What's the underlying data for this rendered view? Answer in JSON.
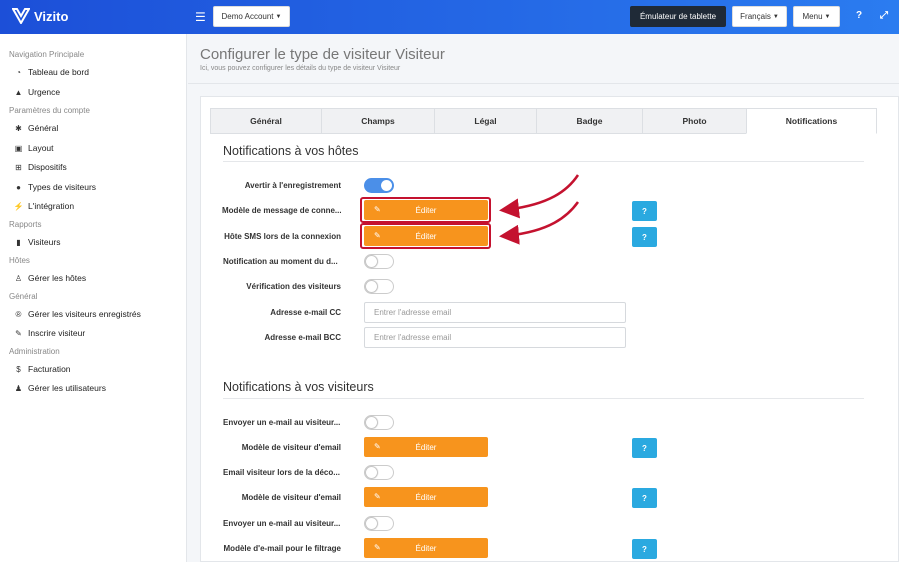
{
  "app": {
    "name": "Vizito"
  },
  "topbar": {
    "account": "Demo Account",
    "tablet_emulator": "Émulateur de tablette",
    "language": "Français",
    "menu": "Menu",
    "help_icon": "?"
  },
  "sidebar": {
    "sections": [
      {
        "title": "Navigation Principale",
        "items": [
          {
            "label": "Tableau de bord",
            "icon": "dashboard-icon"
          },
          {
            "label": "Urgence",
            "icon": "warning-icon"
          }
        ]
      },
      {
        "title": "Paramètres du compte",
        "items": [
          {
            "label": "Général",
            "icon": "gear-icon"
          },
          {
            "label": "Layout",
            "icon": "image-icon"
          },
          {
            "label": "Dispositifs",
            "icon": "sitemap-icon"
          },
          {
            "label": "Types de visiteurs",
            "icon": "users-icon"
          },
          {
            "label": "L'intégration",
            "icon": "plug-icon"
          }
        ]
      },
      {
        "title": "Rapports",
        "items": [
          {
            "label": "Visiteurs",
            "icon": "book-icon"
          }
        ]
      },
      {
        "title": "Hôtes",
        "items": [
          {
            "label": "Gérer les hôtes",
            "icon": "person-icon"
          }
        ]
      },
      {
        "title": "Général",
        "items": [
          {
            "label": "Gérer les visiteurs enregistrés",
            "icon": "registered-icon"
          },
          {
            "label": "Inscrire visiteur",
            "icon": "pencil-icon"
          }
        ]
      },
      {
        "title": "Administration",
        "items": [
          {
            "label": "Facturation",
            "icon": "dollar-icon"
          },
          {
            "label": "Gérer les utilisateurs",
            "icon": "user-plus-icon"
          }
        ]
      }
    ]
  },
  "page": {
    "title": "Configurer le type de visiteur Visiteur",
    "subtitle": "Ici, vous pouvez configurer les détails du type de visiteur Visiteur"
  },
  "tabs": [
    "Général",
    "Champs",
    "Légal",
    "Badge",
    "Photo",
    "Notifications"
  ],
  "hosts": {
    "title": "Notifications à vos hôtes",
    "rows": {
      "notify_register": "Avertir à l'enregistrement",
      "message_template": "Modèle de message de conne...",
      "sms_host": "Hôte SMS lors de la connexion",
      "notify_moment": "Notification au moment du d...",
      "visitor_check": "Vérification des visiteurs",
      "cc_email": "Adresse e-mail CC",
      "bcc_email": "Adresse e-mail BCC"
    },
    "cc_placeholder": "Entrer l'adresse email",
    "bcc_placeholder": "Entrer l'adresse email",
    "notify_register_on": true
  },
  "visitors": {
    "title": "Notifications à vos visiteurs",
    "rows": {
      "send_email_1": "Envoyer un e-mail au visiteur...",
      "email_template_1": "Modèle de visiteur d'email",
      "email_logout": "Email visiteur lors de la déco...",
      "email_template_2": "Modèle de visiteur d'email",
      "send_email_2": "Envoyer un e-mail au visiteur...",
      "filter_template": "Modèle d'e-mail pour le filtrage"
    }
  },
  "buttons": {
    "edit": "Éditer",
    "help": "?"
  },
  "colors": {
    "accent": "#f7941d",
    "primary": "#2b7cf0",
    "info": "#2aa9e0",
    "highlight": "#c4122f"
  }
}
